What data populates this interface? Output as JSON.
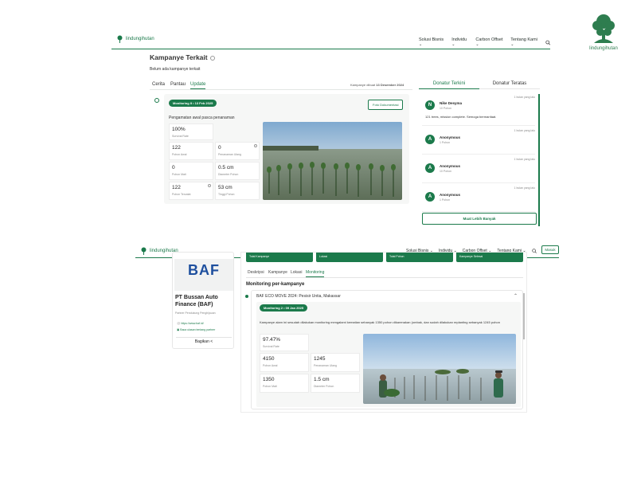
{
  "corner_logo": {
    "caption": "lindungihutan"
  },
  "top_nav": {
    "brand": "lindungihutan",
    "menu": [
      "Solusi Bisnis",
      "Individu",
      "Carbon Offset",
      "Tentang Kami"
    ]
  },
  "campaign": {
    "title": "Kampanye Terkait",
    "empty_text": "Belum ada kampanye terkait",
    "tabs": [
      "Cerita",
      "Pantau",
      "Update"
    ],
    "active_tab": "Update",
    "created_label": "Kampanye dibuat",
    "created_date": "13 Desember 2024"
  },
  "update": {
    "badge": "Monitoring II • 13 Feb 2025",
    "doc_button": "Foto Dokumentasi",
    "heading": "Pengamatan awal pasca penanaman",
    "stats": [
      {
        "value": "100%",
        "label": "Survival Rate"
      },
      {
        "value": "122",
        "label": "Pohon Awal"
      },
      {
        "value": "0",
        "label": "Penanaman Ulang"
      },
      {
        "value": "0",
        "label": "Pohon Mati"
      },
      {
        "value": "0.5 cm",
        "label": "Diameter Pohon"
      },
      {
        "value": "122",
        "label": "Pohon Tercatat"
      },
      {
        "value": "53 cm",
        "label": "Tinggi Pohon"
      }
    ]
  },
  "donors": {
    "tabs": [
      "Donatur Terkini",
      "Donatur Teratas"
    ],
    "items": [
      {
        "initial": "N",
        "name": "Nike Desyma",
        "amount": "10 Pohon",
        "time": "1 bulan yang lalu",
        "message": "121 trees, mission complete. Semoga bermanfaat."
      },
      {
        "initial": "A",
        "name": "Anonymous",
        "amount": "1 Pohon",
        "time": "1 bulan yang lalu",
        "message": ""
      },
      {
        "initial": "A",
        "name": "Anonymous",
        "amount": "10 Pohon",
        "time": "1 bulan yang lalu",
        "message": ""
      },
      {
        "initial": "A",
        "name": "Anonymous",
        "amount": "1 Pohon",
        "time": "1 bulan yang lalu",
        "message": ""
      }
    ],
    "more_button": "Muat Lebih Banyak"
  },
  "lower_nav": {
    "brand": "lindungihutan",
    "menu": [
      "Solusi Bisnis",
      "Individu",
      "Carbon Offset",
      "Tentang Kami"
    ],
    "login": "Masuk"
  },
  "profile": {
    "logo_text": "BAF",
    "company": "PT Bussan Auto Finance (BAF)",
    "role": "Partner Pendukung Penghijauan",
    "website": "https://www.baf.id/",
    "info_link": "Baca ulasan tentang partner",
    "share": "Bagikan"
  },
  "monitoring": {
    "top_chips": [
      "Total Kampanye",
      "Lokasi",
      "Total Pohon",
      "Kampanye Selesai"
    ],
    "tabs": [
      "Deskripsi",
      "Kampanye",
      "Lokasi",
      "Monitoring"
    ],
    "active_tab": "Monitoring",
    "title": "Monitoring per-kampanye",
    "campaign_name": "BAF ECO MOVE 2024: Pesisir Untia, Makassar",
    "badge": "Monitoring 2 • 09 Jan 2025",
    "description": "Kampanye alam ini sesudah dilakukan monitoring mengalami kematian sebanyak 1350 pohon dikarenakan (ombak, dan sudah dilakukan replanting sebanyak 1245 pohon",
    "stats": [
      {
        "value": "97.47%",
        "label": "Survival Rate"
      },
      {
        "value": "4150",
        "label": "Pohon Awal"
      },
      {
        "value": "1245",
        "label": "Penanaman Ulang"
      },
      {
        "value": "1350",
        "label": "Pohon Mati"
      },
      {
        "value": "1.5 cm",
        "label": "Diameter Pohon"
      }
    ]
  },
  "colors": {
    "brand_green": "#1b7a4b"
  }
}
